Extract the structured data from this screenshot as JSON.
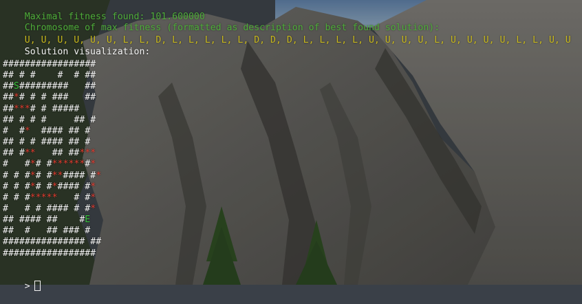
{
  "terminal": {
    "line_fitness": "Maximal fitness found: 101.600000",
    "line_chromosome_header": "Chromosome of max fitness (formatted as description of best found solution):",
    "line_chromosome": "U, U, U, U, U, U, L, L, D, L, L, L, L, L, D, D, D, L, L, L, L, U, U, U, U, L, U, U, U, U, L, L, U, U",
    "line_visualization": "Solution visualization:",
    "maze": [
      "#################",
      "## # #    #  # ##",
      "##S#########   ##",
      "##*# # # ###   ##",
      "##***# # #####",
      "## # # #     ## #",
      "#  #*  #### ## #",
      "## # # #### ## #",
      "## #**   ## ##***",
      "#   #*# #******#*",
      "# # #*# #**#### #*",
      "# # #*# #*#### #*",
      "# # #*****   # #*",
      "#   # # #### # #*",
      "## #### ##    #E",
      "##  #   ## ### #",
      "############### ##",
      "#################"
    ],
    "prompt_symbol": ">"
  },
  "colors": {
    "green": "#4fae3a",
    "yellow": "#c8b81c",
    "path_red": "#e33a2e",
    "white": "#f4f4f4"
  }
}
